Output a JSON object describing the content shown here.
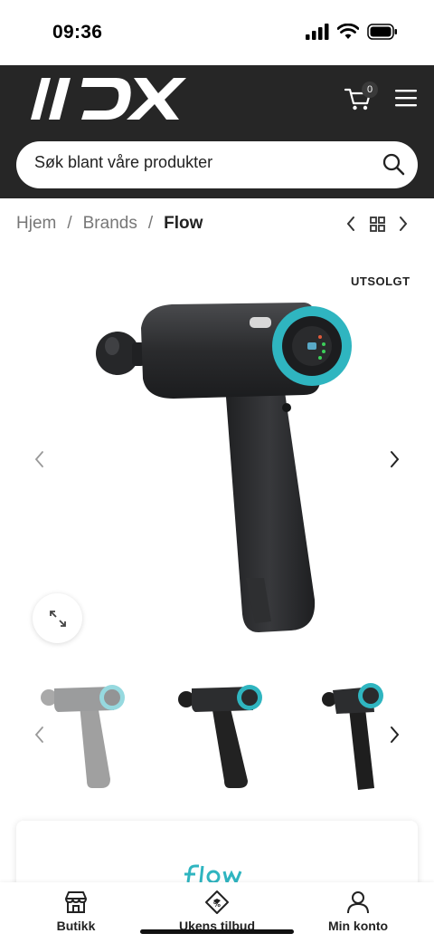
{
  "status_bar": {
    "time": "09:36"
  },
  "header": {
    "logo_text": "MDX",
    "cart_count": "0"
  },
  "search": {
    "placeholder": "Søk blant våre produkter"
  },
  "breadcrumb": {
    "items": [
      "Hjem",
      "Brands"
    ],
    "current": "Flow",
    "separator": "/"
  },
  "product": {
    "badge": "UTSOLGT",
    "accent_color": "#2fb5c0",
    "body_color": "#2a2b2d"
  },
  "brand": {
    "logo_text": "flow"
  },
  "bottom_nav": {
    "items": [
      {
        "label": "Butikk",
        "icon": "store-icon"
      },
      {
        "label": "Ukens tilbud",
        "icon": "tag-icon"
      },
      {
        "label": "Min konto",
        "icon": "user-icon"
      }
    ]
  }
}
